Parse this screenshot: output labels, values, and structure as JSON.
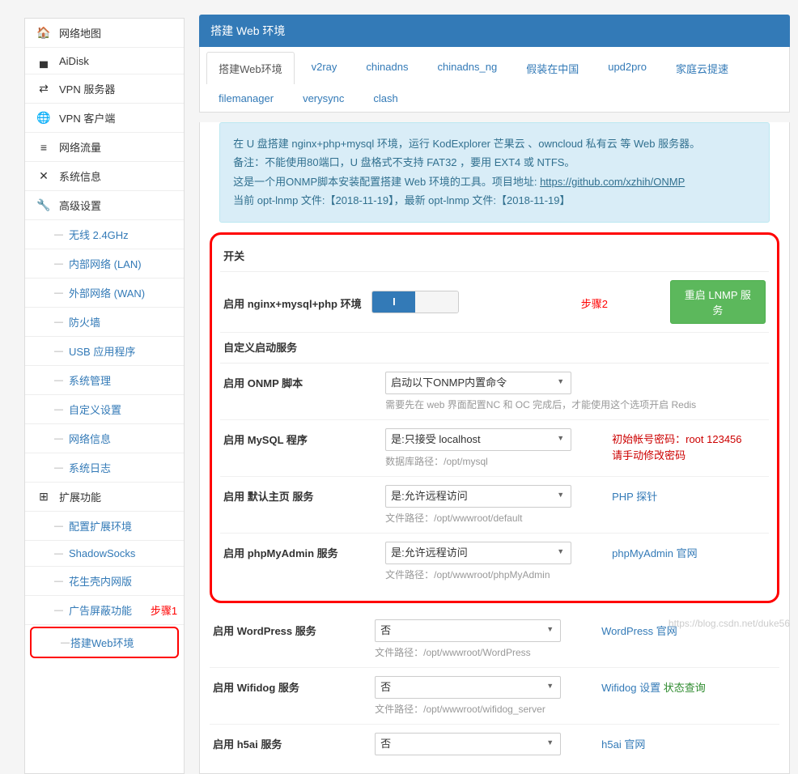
{
  "sidebar": {
    "items": [
      {
        "label": "网络地图",
        "icon": "🏠",
        "type": "parent"
      },
      {
        "label": "AiDisk",
        "icon": "▀",
        "type": "parent"
      },
      {
        "label": "VPN 服务器",
        "icon": "⇄",
        "type": "parent"
      },
      {
        "label": "VPN 客户端",
        "icon": "🌐",
        "type": "parent"
      },
      {
        "label": "网络流量",
        "icon": "≡",
        "type": "parent"
      },
      {
        "label": "系统信息",
        "icon": "✕",
        "type": "parent"
      },
      {
        "label": "高级设置",
        "icon": "🔧",
        "type": "parent"
      },
      {
        "label": "无线 2.4GHz",
        "type": "child"
      },
      {
        "label": "内部网络 (LAN)",
        "type": "child"
      },
      {
        "label": "外部网络 (WAN)",
        "type": "child"
      },
      {
        "label": "防火墙",
        "type": "child"
      },
      {
        "label": "USB 应用程序",
        "type": "child"
      },
      {
        "label": "系统管理",
        "type": "child"
      },
      {
        "label": "自定义设置",
        "type": "child"
      },
      {
        "label": "网络信息",
        "type": "child"
      },
      {
        "label": "系统日志",
        "type": "child"
      },
      {
        "label": "扩展功能",
        "icon": "⊞",
        "type": "parent"
      },
      {
        "label": "配置扩展环境",
        "type": "child"
      },
      {
        "label": "ShadowSocks",
        "type": "child"
      },
      {
        "label": "花生壳内网版",
        "type": "child"
      },
      {
        "label": "广告屏蔽功能",
        "type": "child"
      },
      {
        "label": "搭建Web环境",
        "type": "child",
        "highlight": true
      }
    ],
    "step1": "步骤1"
  },
  "panel": {
    "title": "搭建 Web 环境"
  },
  "tabs": [
    {
      "label": "搭建Web环境",
      "active": true
    },
    {
      "label": "v2ray"
    },
    {
      "label": "chinadns"
    },
    {
      "label": "chinadns_ng"
    },
    {
      "label": "假装在中国"
    },
    {
      "label": "upd2pro"
    },
    {
      "label": "家庭云提速"
    },
    {
      "label": "filemanager"
    },
    {
      "label": "verysync"
    },
    {
      "label": "clash"
    }
  ],
  "info": {
    "line1": "在 U 盘搭建 nginx+php+mysql 环境，运行 KodExplorer 芒果云 、owncloud 私有云 等 Web 服务器。",
    "line2": "备注：不能使用80端口，U 盘格式不支持 FAT32 ，要用 EXT4 或 NTFS。",
    "line3_a": "这是一个用ONMP脚本安装配置搭建 Web 环境的工具。项目地址: ",
    "line3_b": "https://github.com/xzhih/ONMP",
    "line4": "当前 opt-lnmp 文件:【2018-11-19】，最新 opt-lnmp 文件:【2018-11-19】"
  },
  "sections": {
    "switch_title": "开关",
    "custom_title": "自定义启动服务"
  },
  "rows": {
    "enable_env": {
      "label": "启用 nginx+mysql+php 环境",
      "toggle_on": "I",
      "step": "步骤2",
      "btn": "重启 LNMP 服务"
    },
    "onmp": {
      "label": "启用 ONMP 脚本",
      "select": "启动以下ONMP内置命令",
      "hint": "需要先在 web 界面配置NC 和 OC 完成后，才能使用这个选项开启 Redis"
    },
    "mysql": {
      "label": "启用 MySQL 程序",
      "select": "是:只接受 localhost",
      "hint": "数据库路径：/opt/mysql",
      "extra1": "初始帐号密码：root 123456",
      "extra2": "请手动修改密码"
    },
    "default_home": {
      "label": "启用 默认主页 服务",
      "select": "是:允许远程访问",
      "hint": "文件路径：/opt/wwwroot/default",
      "link": "PHP 探针"
    },
    "phpmyadmin": {
      "label": "启用 phpMyAdmin 服务",
      "select": "是:允许远程访问",
      "hint": "文件路径：/opt/wwwroot/phpMyAdmin",
      "link": "phpMyAdmin 官网"
    },
    "wordpress": {
      "label": "启用 WordPress 服务",
      "select": "否",
      "hint": "文件路径：/opt/wwwroot/WordPress",
      "link": "WordPress 官网"
    },
    "wifidog": {
      "label": "启用 Wifidog 服务",
      "select": "否",
      "hint": "文件路径：/opt/wwwroot/wifidog_server",
      "link1": "Wifidog 设置",
      "link2": "状态查询"
    },
    "h5ai": {
      "label": "启用 h5ai 服务",
      "select": "否",
      "link": "h5ai 官网"
    }
  },
  "watermark": "https://blog.csdn.net/duke56"
}
